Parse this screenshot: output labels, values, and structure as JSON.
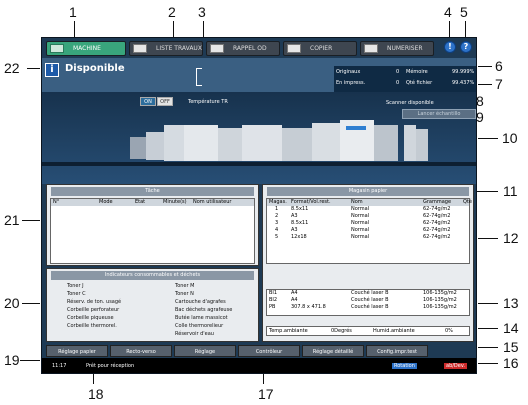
{
  "callouts": [
    "1",
    "2",
    "3",
    "4",
    "5",
    "6",
    "7",
    "8",
    "9",
    "10",
    "11",
    "12",
    "13",
    "14",
    "15",
    "16",
    "17",
    "18",
    "19",
    "20",
    "21",
    "22"
  ],
  "tabs": [
    "MACHINE",
    "LISTE TRAVAUX",
    "RAPPEL OD",
    "COPIER",
    "NUMERISER"
  ],
  "help_icons": [
    "!",
    "?"
  ],
  "status": {
    "title": "Disponible",
    "info_glyph": "i"
  },
  "counter": {
    "originals_label": "Originaux",
    "originals_value": "0",
    "memory_label": "Mémoire",
    "memory_value": "99.999%",
    "printing_label": "En impress.",
    "printing_value": "0",
    "file_label": "Qté fichier",
    "file_value": "99.437%"
  },
  "temperature": {
    "on": "ON",
    "off": "OFF",
    "label": "Température TR"
  },
  "scanner": {
    "status": "Scanner disponible",
    "sample_button": "Lancer échantillo"
  },
  "jobs": {
    "title": "Tâche",
    "headers": [
      "N°",
      "Mode",
      "Etat",
      "Minute(s)",
      "Nom utilisateur"
    ]
  },
  "tray": {
    "title": "Magasin papier",
    "headers": [
      "Magas.",
      "Format/Vol.rest.",
      "Nom",
      "Grammage",
      "Qté"
    ],
    "rows": [
      [
        "1",
        "8.5x11",
        "Normal",
        "62-74g/m2"
      ],
      [
        "2",
        "A3",
        "Normal",
        "62-74g/m2"
      ],
      [
        "3",
        "8.5x11",
        "Normal",
        "62-74g/m2"
      ],
      [
        "4",
        "A3",
        "Normal",
        "62-74g/m2"
      ],
      [
        "5",
        "12x18",
        "Normal",
        "62-74g/m2"
      ]
    ],
    "large_rows": [
      [
        "BI1",
        "A4",
        "Couché laser B",
        "106-135g/m2"
      ],
      [
        "BI2",
        "A4",
        "Couché laser B",
        "106-135g/m2"
      ],
      [
        "PB",
        "307.8 x 471.8",
        "Couché laser B",
        "106-135g/m2"
      ]
    ],
    "env": {
      "temp_label": "Temp.ambiante",
      "temp_value": "0Degrés",
      "humid_label": "Humid.ambiante",
      "humid_value": "0%"
    }
  },
  "consumables": {
    "title": "Indicateurs consommables et déchets",
    "left": [
      "Toner J",
      "Toner C",
      "Réserv. de ton. usagé",
      "Corbeille perforateur",
      "Corbeille piqueuse",
      "Corbeille thermorel."
    ],
    "right": [
      "Toner M",
      "Toner N",
      "Cartouche d'agrafes",
      "Bac déchets agrafeuse",
      "Butée lame massicot",
      "Colle thermorelieur",
      "Réservoir d'eau"
    ]
  },
  "buttons": [
    "Réglage papier",
    "Recto-verso",
    "Réglage",
    "Contrôleur",
    "Réglage détaillé",
    "Config.impr.test"
  ],
  "statusbar": {
    "time": "11:17",
    "message": "Prêt pour réception",
    "rotation": "Rotation",
    "job": "ab/Dev."
  }
}
